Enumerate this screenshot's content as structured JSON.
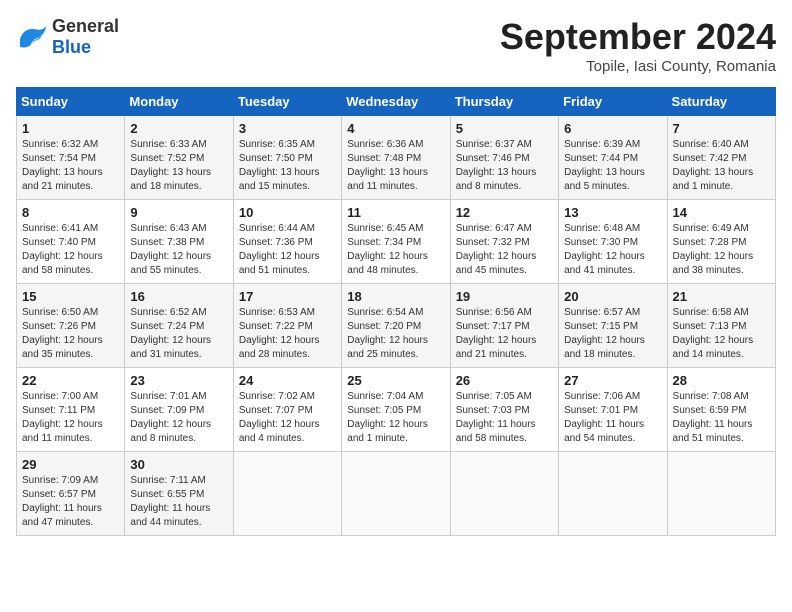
{
  "header": {
    "logo_general": "General",
    "logo_blue": "Blue",
    "month": "September 2024",
    "location": "Topile, Iasi County, Romania"
  },
  "weekdays": [
    "Sunday",
    "Monday",
    "Tuesday",
    "Wednesday",
    "Thursday",
    "Friday",
    "Saturday"
  ],
  "weeks": [
    [
      {
        "day": "1",
        "info": "Sunrise: 6:32 AM\nSunset: 7:54 PM\nDaylight: 13 hours\nand 21 minutes."
      },
      {
        "day": "2",
        "info": "Sunrise: 6:33 AM\nSunset: 7:52 PM\nDaylight: 13 hours\nand 18 minutes."
      },
      {
        "day": "3",
        "info": "Sunrise: 6:35 AM\nSunset: 7:50 PM\nDaylight: 13 hours\nand 15 minutes."
      },
      {
        "day": "4",
        "info": "Sunrise: 6:36 AM\nSunset: 7:48 PM\nDaylight: 13 hours\nand 11 minutes."
      },
      {
        "day": "5",
        "info": "Sunrise: 6:37 AM\nSunset: 7:46 PM\nDaylight: 13 hours\nand 8 minutes."
      },
      {
        "day": "6",
        "info": "Sunrise: 6:39 AM\nSunset: 7:44 PM\nDaylight: 13 hours\nand 5 minutes."
      },
      {
        "day": "7",
        "info": "Sunrise: 6:40 AM\nSunset: 7:42 PM\nDaylight: 13 hours\nand 1 minute."
      }
    ],
    [
      {
        "day": "8",
        "info": "Sunrise: 6:41 AM\nSunset: 7:40 PM\nDaylight: 12 hours\nand 58 minutes."
      },
      {
        "day": "9",
        "info": "Sunrise: 6:43 AM\nSunset: 7:38 PM\nDaylight: 12 hours\nand 55 minutes."
      },
      {
        "day": "10",
        "info": "Sunrise: 6:44 AM\nSunset: 7:36 PM\nDaylight: 12 hours\nand 51 minutes."
      },
      {
        "day": "11",
        "info": "Sunrise: 6:45 AM\nSunset: 7:34 PM\nDaylight: 12 hours\nand 48 minutes."
      },
      {
        "day": "12",
        "info": "Sunrise: 6:47 AM\nSunset: 7:32 PM\nDaylight: 12 hours\nand 45 minutes."
      },
      {
        "day": "13",
        "info": "Sunrise: 6:48 AM\nSunset: 7:30 PM\nDaylight: 12 hours\nand 41 minutes."
      },
      {
        "day": "14",
        "info": "Sunrise: 6:49 AM\nSunset: 7:28 PM\nDaylight: 12 hours\nand 38 minutes."
      }
    ],
    [
      {
        "day": "15",
        "info": "Sunrise: 6:50 AM\nSunset: 7:26 PM\nDaylight: 12 hours\nand 35 minutes."
      },
      {
        "day": "16",
        "info": "Sunrise: 6:52 AM\nSunset: 7:24 PM\nDaylight: 12 hours\nand 31 minutes."
      },
      {
        "day": "17",
        "info": "Sunrise: 6:53 AM\nSunset: 7:22 PM\nDaylight: 12 hours\nand 28 minutes."
      },
      {
        "day": "18",
        "info": "Sunrise: 6:54 AM\nSunset: 7:20 PM\nDaylight: 12 hours\nand 25 minutes."
      },
      {
        "day": "19",
        "info": "Sunrise: 6:56 AM\nSunset: 7:17 PM\nDaylight: 12 hours\nand 21 minutes."
      },
      {
        "day": "20",
        "info": "Sunrise: 6:57 AM\nSunset: 7:15 PM\nDaylight: 12 hours\nand 18 minutes."
      },
      {
        "day": "21",
        "info": "Sunrise: 6:58 AM\nSunset: 7:13 PM\nDaylight: 12 hours\nand 14 minutes."
      }
    ],
    [
      {
        "day": "22",
        "info": "Sunrise: 7:00 AM\nSunset: 7:11 PM\nDaylight: 12 hours\nand 11 minutes."
      },
      {
        "day": "23",
        "info": "Sunrise: 7:01 AM\nSunset: 7:09 PM\nDaylight: 12 hours\nand 8 minutes."
      },
      {
        "day": "24",
        "info": "Sunrise: 7:02 AM\nSunset: 7:07 PM\nDaylight: 12 hours\nand 4 minutes."
      },
      {
        "day": "25",
        "info": "Sunrise: 7:04 AM\nSunset: 7:05 PM\nDaylight: 12 hours\nand 1 minute."
      },
      {
        "day": "26",
        "info": "Sunrise: 7:05 AM\nSunset: 7:03 PM\nDaylight: 11 hours\nand 58 minutes."
      },
      {
        "day": "27",
        "info": "Sunrise: 7:06 AM\nSunset: 7:01 PM\nDaylight: 11 hours\nand 54 minutes."
      },
      {
        "day": "28",
        "info": "Sunrise: 7:08 AM\nSunset: 6:59 PM\nDaylight: 11 hours\nand 51 minutes."
      }
    ],
    [
      {
        "day": "29",
        "info": "Sunrise: 7:09 AM\nSunset: 6:57 PM\nDaylight: 11 hours\nand 47 minutes."
      },
      {
        "day": "30",
        "info": "Sunrise: 7:11 AM\nSunset: 6:55 PM\nDaylight: 11 hours\nand 44 minutes."
      },
      {
        "day": "",
        "info": ""
      },
      {
        "day": "",
        "info": ""
      },
      {
        "day": "",
        "info": ""
      },
      {
        "day": "",
        "info": ""
      },
      {
        "day": "",
        "info": ""
      }
    ]
  ]
}
